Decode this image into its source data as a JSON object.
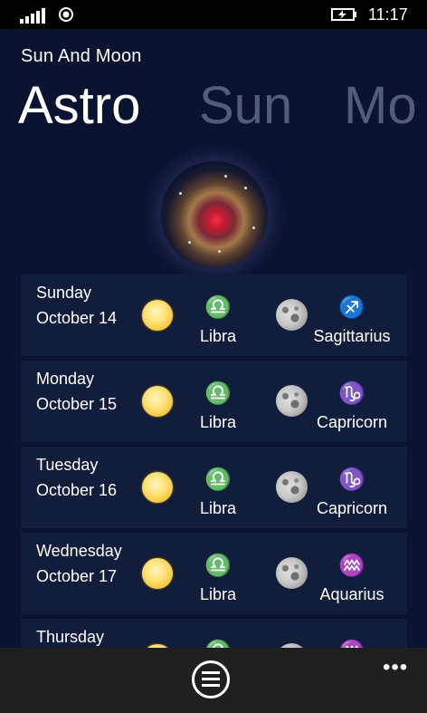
{
  "status_bar": {
    "time": "11:17",
    "icons": [
      "signal-strength-icon",
      "data-connection-icon",
      "battery-charging-icon"
    ]
  },
  "app": {
    "title": "Sun And Moon",
    "pivot": [
      "Astro",
      "Sun",
      "Mo"
    ],
    "active_tab": "Astro"
  },
  "days": [
    {
      "weekday": "Sunday",
      "date": "October 14",
      "sun_symbol": "♎",
      "sun_sign": "Libra",
      "moon_symbol": "♐",
      "moon_sign": "Sagittarius"
    },
    {
      "weekday": "Monday",
      "date": "October 15",
      "sun_symbol": "♎",
      "sun_sign": "Libra",
      "moon_symbol": "♑",
      "moon_sign": "Capricorn"
    },
    {
      "weekday": "Tuesday",
      "date": "October 16",
      "sun_symbol": "♎",
      "sun_sign": "Libra",
      "moon_symbol": "♑",
      "moon_sign": "Capricorn"
    },
    {
      "weekday": "Wednesday",
      "date": "October 17",
      "sun_symbol": "♎",
      "sun_sign": "Libra",
      "moon_symbol": "♒",
      "moon_sign": "Aquarius"
    },
    {
      "weekday": "Thursday",
      "date": "",
      "sun_symbol": "♎",
      "sun_sign": "",
      "moon_symbol": "♒",
      "moon_sign": ""
    }
  ],
  "app_bar": {
    "button_icon": "list-icon",
    "more_label": "•••"
  },
  "colors": {
    "background": "#0a1431",
    "row_background": "#101d3b",
    "inactive_pivot": "#4f5e79",
    "app_bar": "#1f1f1f"
  }
}
